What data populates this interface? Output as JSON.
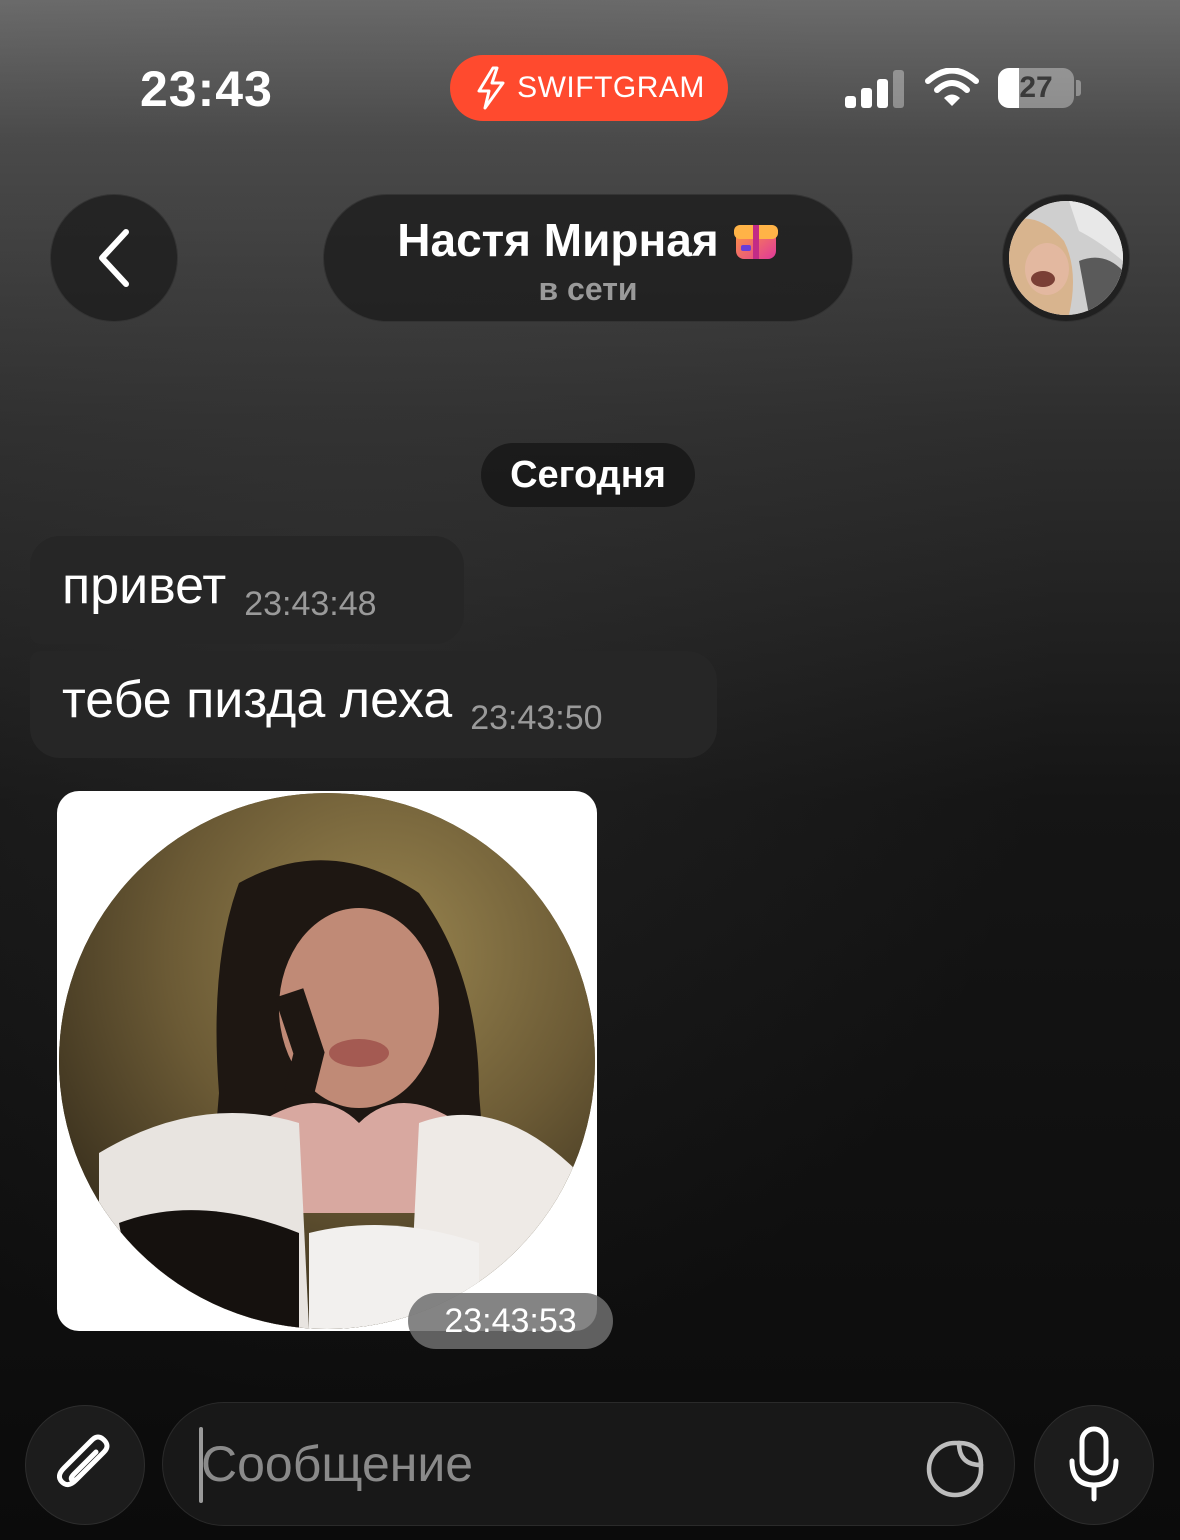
{
  "status_bar": {
    "time": "23:43",
    "badge_label": "SWIFTGRAM",
    "badge_color": "#ff4a2e",
    "battery_text": "27",
    "battery_level": 0.27
  },
  "header": {
    "contact_name": "Настя Мирная",
    "contact_status": "в сети"
  },
  "chat": {
    "date_label": "Сегодня",
    "messages": [
      {
        "text": "привет",
        "time": "23:43:48"
      },
      {
        "text": "тебе пизда леха",
        "time": "23:43:50"
      },
      {
        "type": "photo",
        "time": "23:43:53"
      }
    ]
  },
  "input": {
    "placeholder": "Сообщение"
  },
  "colors": {
    "bubble": "#262626",
    "muted_text": "#9a9a9a"
  }
}
